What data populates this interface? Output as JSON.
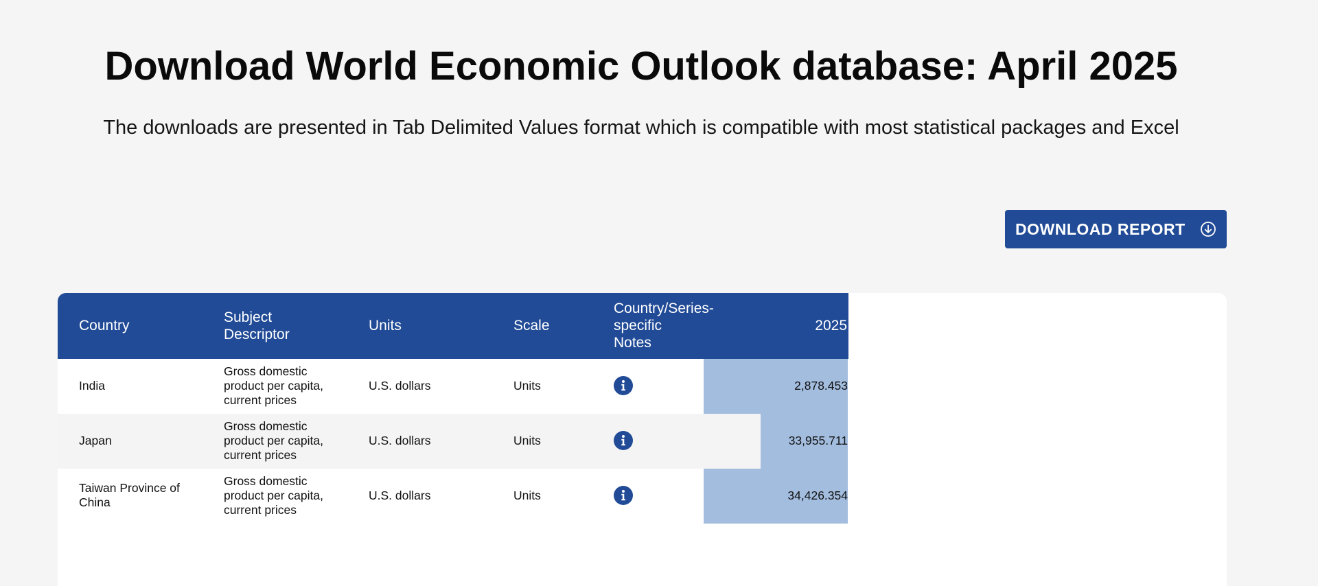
{
  "page": {
    "title": "Download World Economic Outlook database: April 2025",
    "subtitle": "The downloads are presented in Tab Delimited Values format which is compatible with most statistical packages and Excel"
  },
  "download": {
    "label": "DOWNLOAD REPORT",
    "icon": "arrow-down-circle-icon"
  },
  "table": {
    "columns": [
      "Country",
      "Subject Descriptor",
      "Units",
      "Scale",
      "Country/Series-specific Notes",
      "2025"
    ],
    "header_lines": {
      "country": "Country",
      "subject_1": "Subject",
      "subject_2": "Descriptor",
      "units": "Units",
      "scale": "Scale",
      "notes_1": "Country/Series-",
      "notes_2": "specific",
      "notes_3": "Notes",
      "year": "2025"
    },
    "rows": [
      {
        "country": "India",
        "country_lines": [
          "India"
        ],
        "subject": "Gross domestic product per capita, current prices",
        "subject_lines": [
          "Gross domestic",
          "product per capita,",
          "current prices"
        ],
        "units": "U.S. dollars",
        "scale": "Units",
        "notes_icon": "info-icon",
        "value": "2,878.453"
      },
      {
        "country": "Japan",
        "country_lines": [
          "Japan"
        ],
        "subject": "Gross domestic product per capita, current prices",
        "subject_lines": [
          "Gross domestic",
          "product per capita,",
          "current prices"
        ],
        "units": "U.S. dollars",
        "scale": "Units",
        "notes_icon": "info-icon",
        "value": "33,955.711"
      },
      {
        "country": "Taiwan Province of China",
        "country_lines": [
          "Taiwan Province of",
          "China"
        ],
        "subject": "Gross domestic product per capita, current prices",
        "subject_lines": [
          "Gross domestic",
          "product per capita,",
          "current prices"
        ],
        "units": "U.S. dollars",
        "scale": "Units",
        "notes_icon": "info-icon",
        "value": "34,426.354"
      }
    ]
  },
  "colors": {
    "brand_blue": "#214b96",
    "highlight_column": "#a3bddf",
    "background": "#f5f5f5"
  }
}
